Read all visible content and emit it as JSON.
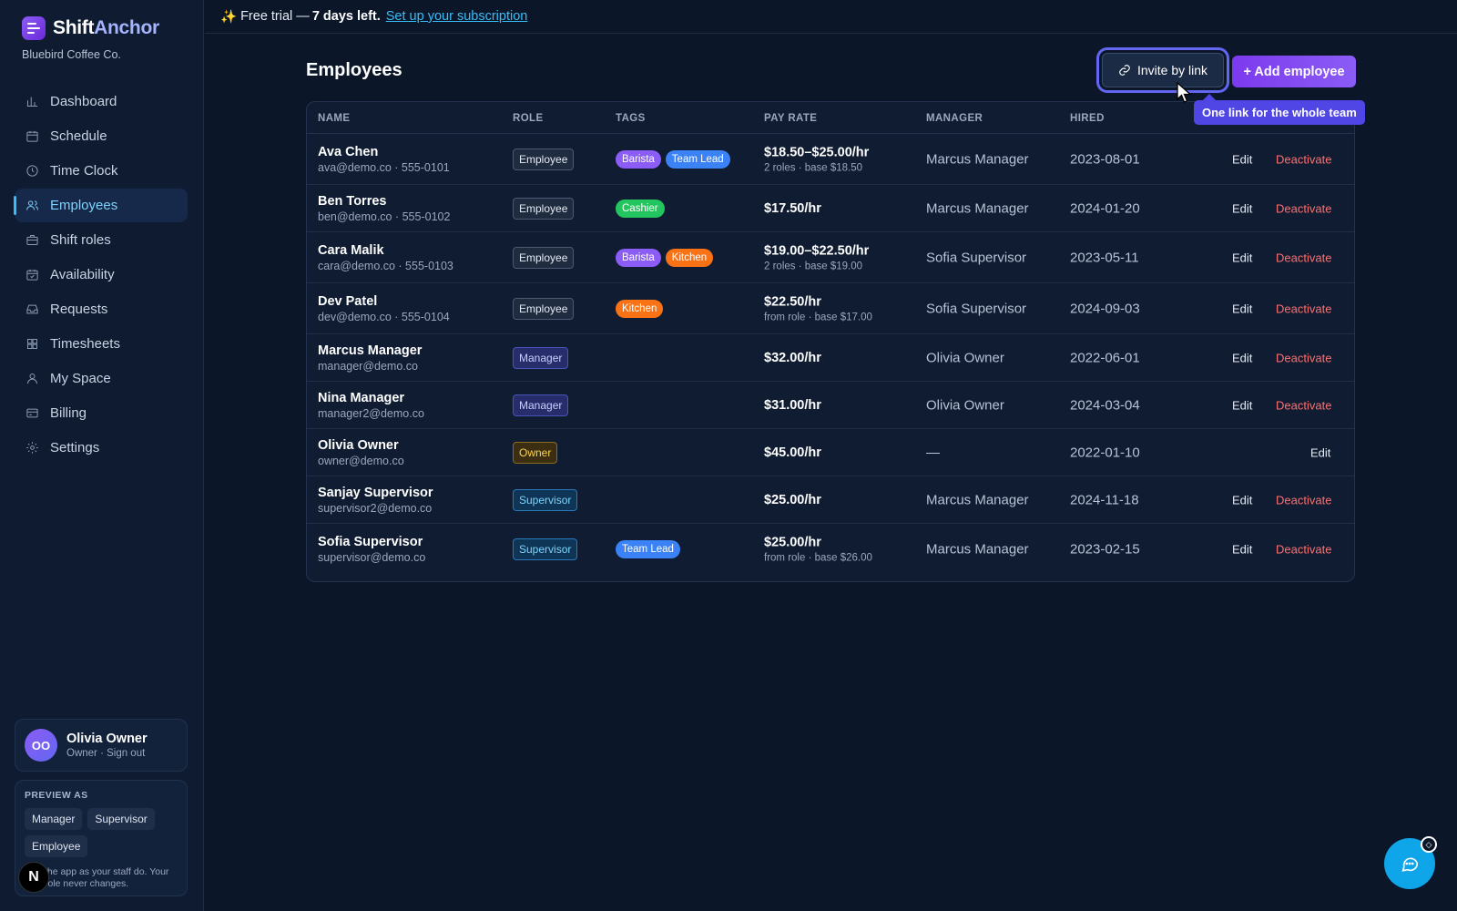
{
  "app": {
    "name_part1": "Shift",
    "name_part2": "Anchor",
    "org": "Bluebird Coffee Co."
  },
  "nav": [
    {
      "label": "Dashboard",
      "icon": "bar-chart-icon"
    },
    {
      "label": "Schedule",
      "icon": "calendar-icon"
    },
    {
      "label": "Time Clock",
      "icon": "clock-icon"
    },
    {
      "label": "Employees",
      "icon": "users-icon",
      "active": true
    },
    {
      "label": "Shift roles",
      "icon": "briefcase-icon"
    },
    {
      "label": "Availability",
      "icon": "calendar-check-icon"
    },
    {
      "label": "Requests",
      "icon": "inbox-icon"
    },
    {
      "label": "Timesheets",
      "icon": "grid-icon"
    },
    {
      "label": "My Space",
      "icon": "user-icon"
    },
    {
      "label": "Billing",
      "icon": "credit-card-icon"
    },
    {
      "label": "Settings",
      "icon": "gear-icon"
    }
  ],
  "user": {
    "initials": "OO",
    "name": "Olivia Owner",
    "sub": "Owner · Sign out"
  },
  "preview": {
    "title": "PREVIEW AS",
    "chips": [
      "Manager",
      "Supervisor",
      "Employee"
    ],
    "note": "the app as your staff do. Your role never changes."
  },
  "n_badge": "N",
  "trial": {
    "prefix": "Free trial —",
    "bold": "7 days left.",
    "link": "Set up your subscription"
  },
  "page": {
    "title": "Employees",
    "invite_label": "Invite by link",
    "add_label": "+ Add employee",
    "tooltip": "One link for the whole team"
  },
  "columns": {
    "name": "NAME",
    "role": "ROLE",
    "tags": "TAGS",
    "pay": "PAY RATE",
    "manager": "MANAGER",
    "hired": "HIRED"
  },
  "actions": {
    "edit": "Edit",
    "deactivate": "Deactivate"
  },
  "tag_colors": {
    "Barista": "#8b5cf6",
    "Team Lead": "#3b82f6",
    "Cashier": "#22c55e",
    "Kitchen": "#f97316"
  },
  "employees": [
    {
      "name": "Ava Chen",
      "contact": "ava@demo.co · 555-0101",
      "role": "Employee",
      "tags": [
        "Barista",
        "Team Lead"
      ],
      "pay": "$18.50–$25.00/hr",
      "pay_sub": "2 roles · base $18.50",
      "manager": "Marcus Manager",
      "hired": "2023-08-01",
      "deactivate": true
    },
    {
      "name": "Ben Torres",
      "contact": "ben@demo.co · 555-0102",
      "role": "Employee",
      "tags": [
        "Cashier"
      ],
      "pay": "$17.50/hr",
      "pay_sub": "",
      "manager": "Marcus Manager",
      "hired": "2024-01-20",
      "deactivate": true
    },
    {
      "name": "Cara Malik",
      "contact": "cara@demo.co · 555-0103",
      "role": "Employee",
      "tags": [
        "Barista",
        "Kitchen"
      ],
      "pay": "$19.00–$22.50/hr",
      "pay_sub": "2 roles · base $19.00",
      "manager": "Sofia Supervisor",
      "hired": "2023-05-11",
      "deactivate": true
    },
    {
      "name": "Dev Patel",
      "contact": "dev@demo.co · 555-0104",
      "role": "Employee",
      "tags": [
        "Kitchen"
      ],
      "pay": "$22.50/hr",
      "pay_sub": "from role · base $17.00",
      "manager": "Sofia Supervisor",
      "hired": "2024-09-03",
      "deactivate": true
    },
    {
      "name": "Marcus Manager",
      "contact": "manager@demo.co",
      "role": "Manager",
      "tags": [],
      "pay": "$32.00/hr",
      "pay_sub": "",
      "manager": "Olivia Owner",
      "hired": "2022-06-01",
      "deactivate": true
    },
    {
      "name": "Nina Manager",
      "contact": "manager2@demo.co",
      "role": "Manager",
      "tags": [],
      "pay": "$31.00/hr",
      "pay_sub": "",
      "manager": "Olivia Owner",
      "hired": "2024-03-04",
      "deactivate": true
    },
    {
      "name": "Olivia Owner",
      "contact": "owner@demo.co",
      "role": "Owner",
      "tags": [],
      "pay": "$45.00/hr",
      "pay_sub": "",
      "manager": "—",
      "hired": "2022-01-10",
      "deactivate": false
    },
    {
      "name": "Sanjay Supervisor",
      "contact": "supervisor2@demo.co",
      "role": "Supervisor",
      "tags": [],
      "pay": "$25.00/hr",
      "pay_sub": "",
      "manager": "Marcus Manager",
      "hired": "2024-11-18",
      "deactivate": true
    },
    {
      "name": "Sofia Supervisor",
      "contact": "supervisor@demo.co",
      "role": "Supervisor",
      "tags": [
        "Team Lead"
      ],
      "pay": "$25.00/hr",
      "pay_sub": "from role · base $26.00",
      "manager": "Marcus Manager",
      "hired": "2023-02-15",
      "deactivate": true
    }
  ]
}
